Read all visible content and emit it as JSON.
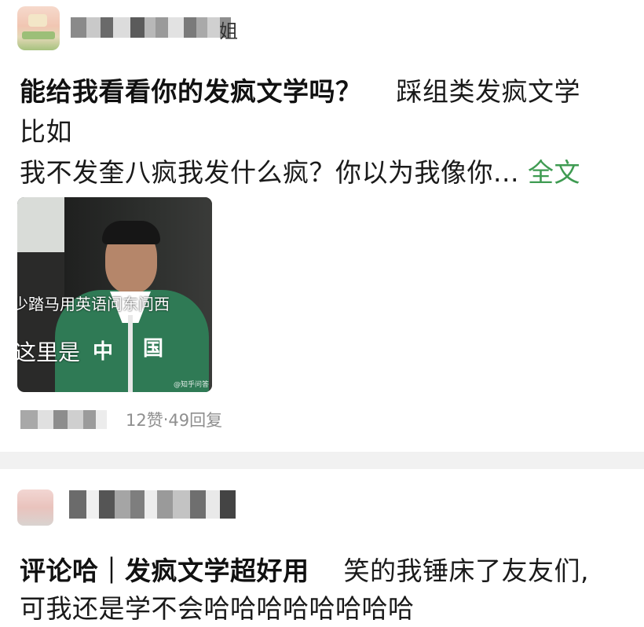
{
  "post1": {
    "name_suffix": "姐",
    "title_bold": "能给我看看你的发疯文学吗？",
    "title_rest": "踩组类发疯文学",
    "line2": "比如",
    "line3_text": "我不发奎八疯我发什么疯？你以为我像你...",
    "full_text_link": "全文",
    "image": {
      "caption_line1": "少踏马用英语问东问西",
      "caption_line2": "这里是",
      "jacket_text_1": "中",
      "jacket_text_2": "国",
      "watermark": "@知乎问答"
    },
    "likes": "12赞",
    "dot": " · ",
    "replies": "49回复"
  },
  "post2": {
    "title_bold": "评论哈｜发疯文学超好用",
    "title_rest": "笑的我锤床了友友们,",
    "line2": "可我还是学不会哈哈哈哈哈哈哈哈"
  },
  "colors": {
    "link_green": "#3f9b52",
    "meta_gray": "#8f8f8f",
    "separator": "#f1f1f1",
    "jacket_green": "#2f7a55"
  },
  "icons": {
    "avatar1": "user-avatar-icon",
    "avatar2": "user-avatar-icon"
  }
}
